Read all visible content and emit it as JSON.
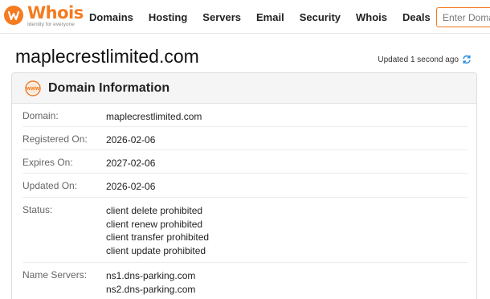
{
  "header": {
    "logo_text": "Whois",
    "logo_tagline": "Identity for everyone",
    "nav": [
      "Domains",
      "Hosting",
      "Servers",
      "Email",
      "Security",
      "Whois",
      "Deals"
    ],
    "search_placeholder": "Enter Domain"
  },
  "page": {
    "title": "maplecrestlimited.com",
    "updated": "Updated 1 second ago"
  },
  "card": {
    "title": "Domain Information",
    "rows": [
      {
        "label": "Domain:",
        "value": "maplecrestlimited.com"
      },
      {
        "label": "Registered On:",
        "value": "2026-02-06"
      },
      {
        "label": "Expires On:",
        "value": "2027-02-06"
      },
      {
        "label": "Updated On:",
        "value": "2026-02-06"
      },
      {
        "label": "Status:",
        "values": [
          "client delete prohibited",
          "client renew prohibited",
          "client transfer prohibited",
          "client update prohibited"
        ]
      },
      {
        "label": "Name Servers:",
        "values": [
          "ns1.dns-parking.com",
          "ns2.dns-parking.com"
        ]
      }
    ]
  },
  "colors": {
    "brand": "#f47b20",
    "refresh": "#2f8ee0"
  }
}
